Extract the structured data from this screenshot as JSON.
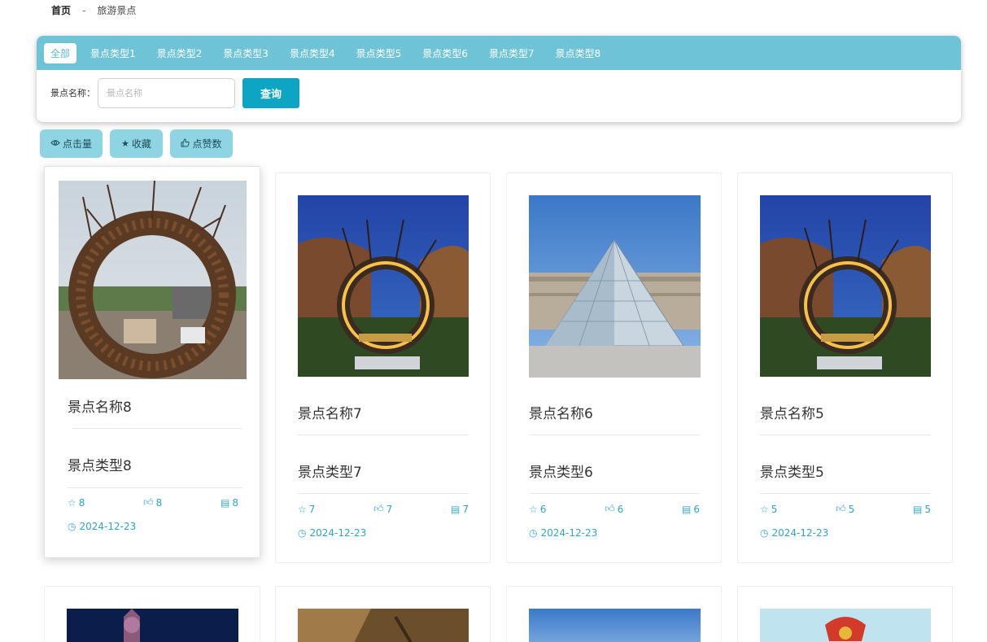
{
  "breadcrumb": {
    "home": "首页",
    "separator": "-",
    "current": "旅游景点"
  },
  "tabs": [
    "全部",
    "景点类型1",
    "景点类型2",
    "景点类型3",
    "景点类型4",
    "景点类型5",
    "景点类型6",
    "景点类型7",
    "景点类型8"
  ],
  "search": {
    "label": "景点名称：",
    "placeholder": "景点名称",
    "value": "",
    "button": "查询"
  },
  "sort_buttons": [
    {
      "icon": "eye-icon",
      "label": "点击量"
    },
    {
      "icon": "star-icon",
      "label": "收藏"
    },
    {
      "icon": "thumb-up-icon",
      "label": "点赞数"
    }
  ],
  "cards": [
    {
      "name": "景点名称8",
      "type": "景点类型8",
      "favorites": "8",
      "likes": "8",
      "comments": "8",
      "date": "2024-12-23",
      "photo": "woven-ring-daytime"
    },
    {
      "name": "景点名称7",
      "type": "景点类型7",
      "favorites": "7",
      "likes": "7",
      "comments": "7",
      "date": "2024-12-23",
      "photo": "woven-ring-night"
    },
    {
      "name": "景点名称6",
      "type": "景点类型6",
      "favorites": "6",
      "likes": "6",
      "comments": "6",
      "date": "2024-12-23",
      "photo": "louvre-pyramid"
    },
    {
      "name": "景点名称5",
      "type": "景点类型5",
      "favorites": "5",
      "likes": "5",
      "comments": "5",
      "date": "2024-12-23",
      "photo": "woven-ring-night"
    }
  ],
  "colors": {
    "accent": "#6ec3d6",
    "button": "#0ea5c4",
    "stat_text": "#2fa6c3"
  }
}
